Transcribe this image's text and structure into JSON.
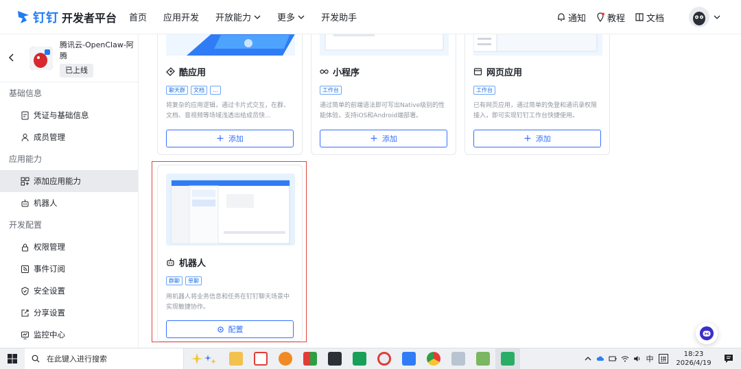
{
  "brand": {
    "name": "钉钉",
    "subtitle": "开发者平台",
    "color": "#1e7cf4"
  },
  "nav": {
    "links": [
      {
        "label": "首页"
      },
      {
        "label": "应用开发"
      },
      {
        "label": "开放能力",
        "dropdown": true
      },
      {
        "label": "更多",
        "dropdown": true
      },
      {
        "label": "开发助手"
      }
    ],
    "right": {
      "notify": "通知",
      "tutorial": "教程",
      "docs": "文档"
    }
  },
  "app": {
    "name": "腾讯云-OpenClaw-阿腾",
    "status": "已上线"
  },
  "sidebar": {
    "groups": [
      {
        "title": "基础信息",
        "items": [
          {
            "label": "凭证与基础信息",
            "icon": "credential-icon"
          },
          {
            "label": "成员管理",
            "icon": "user-icon"
          }
        ]
      },
      {
        "title": "应用能力",
        "items": [
          {
            "label": "添加应用能力",
            "icon": "grid-add-icon",
            "active": true
          },
          {
            "label": "机器人",
            "icon": "robot-icon"
          }
        ]
      },
      {
        "title": "开发配置",
        "items": [
          {
            "label": "权限管理",
            "icon": "lock-icon"
          },
          {
            "label": "事件订阅",
            "icon": "subscribe-icon"
          },
          {
            "label": "安全设置",
            "icon": "shield-icon"
          },
          {
            "label": "分享设置",
            "icon": "share-icon"
          },
          {
            "label": "监控中心",
            "icon": "monitor-icon"
          }
        ]
      }
    ]
  },
  "cards": [
    {
      "title": "酷应用",
      "tags": [
        "聊天群",
        "文档",
        "..."
      ],
      "desc": "将复杂的应用逻辑，通过卡片式交互，在群、文档、音视频等场域浅透出给成员快...",
      "button": "添加"
    },
    {
      "title": "小程序",
      "tags": [
        "工作台"
      ],
      "desc": "通过简单的前端语法即可写出Native级别的性能体验，支持iOS和Android端部署。",
      "button": "添加"
    },
    {
      "title": "网页应用",
      "tags": [
        "工作台"
      ],
      "desc": "已有网页应用，通过简单的免登和通讯录权限接入，即可实现钉钉工作台快捷使用。",
      "button": "添加"
    },
    {
      "title": "机器人",
      "tags": [
        "群聊",
        "单聊"
      ],
      "desc": "用机器人将业务信息和任务在钉钉聊天场景中实现敏捷协作。",
      "button": "配置"
    }
  ],
  "taskbar": {
    "search_placeholder": "在此键入进行搜索",
    "tray_lang": "中",
    "tray_ime": "拼",
    "time": "18:23",
    "date": "2026/4/19"
  },
  "colors": {
    "primary": "#3370ff",
    "highlight": "#e0443c"
  }
}
